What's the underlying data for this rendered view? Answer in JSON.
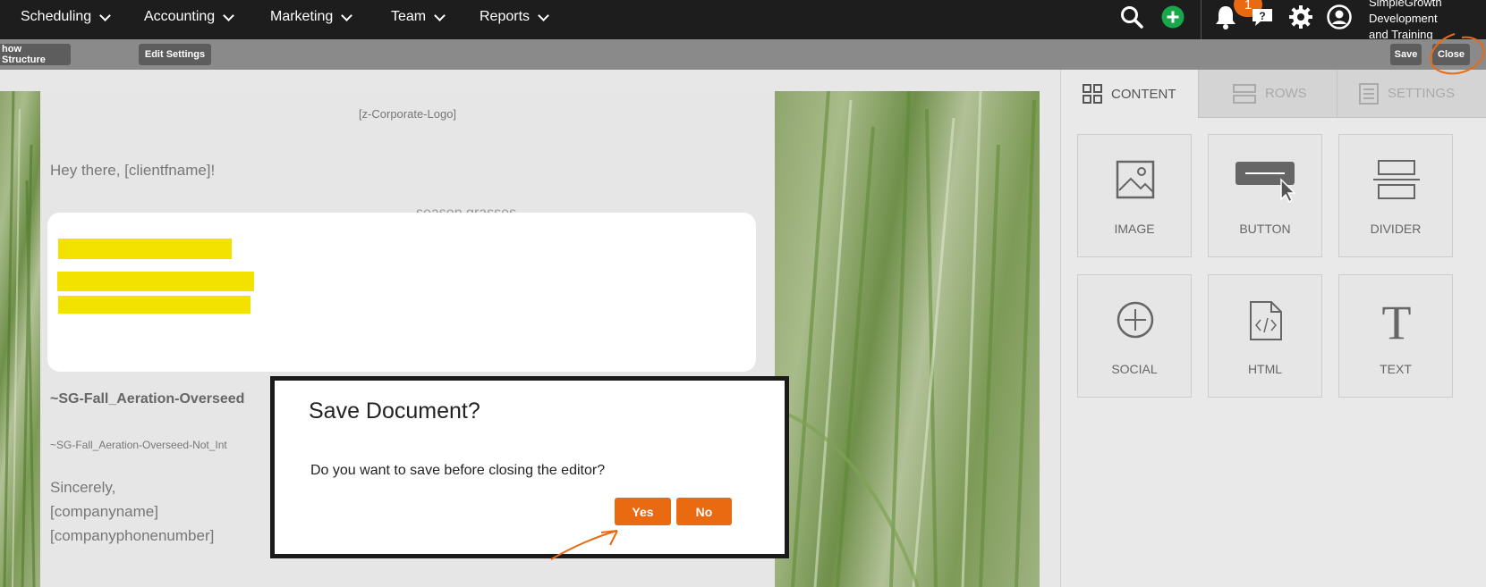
{
  "nav": {
    "items": [
      {
        "label": "Scheduling"
      },
      {
        "label": "Accounting"
      },
      {
        "label": "Marketing"
      },
      {
        "label": "Team"
      },
      {
        "label": "Reports"
      }
    ],
    "notification_count": "1",
    "account_name_lines": [
      "SimpleGrowth",
      "Development",
      "and Training"
    ],
    "colors": {
      "bar": "#1d1d1d",
      "add": "#1aa64a",
      "badge": "#ea6a12"
    }
  },
  "toolbar": {
    "structure_label": "how Structure",
    "settings_label": "Edit Settings",
    "save_label": "Save",
    "close_label": "Close"
  },
  "email": {
    "logo_placeholder": "[z-Corporate-Logo]",
    "greeting": "Hey there, [clientfname]!",
    "partial_line": "season grasses",
    "heading": "~SG-Fall_Aeration-Overseed",
    "small_line": "~SG-Fall_Aeration-Overseed-Not_Int",
    "signature": [
      "Sincerely,",
      "[companyname]",
      "[companyphonenumber]"
    ]
  },
  "panel": {
    "tabs": [
      {
        "label": "CONTENT",
        "icon": "grid-icon"
      },
      {
        "label": "ROWS",
        "icon": "rows-icon"
      },
      {
        "label": "SETTINGS",
        "icon": "settings-doc-icon"
      }
    ],
    "tiles": [
      {
        "label": "IMAGE",
        "icon": "image-icon"
      },
      {
        "label": "BUTTON",
        "icon": "button-icon"
      },
      {
        "label": "DIVIDER",
        "icon": "divider-icon"
      },
      {
        "label": "SOCIAL",
        "icon": "plus-circle-icon"
      },
      {
        "label": "HTML",
        "icon": "code-file-icon"
      },
      {
        "label": "TEXT",
        "icon": "text-t-icon"
      }
    ]
  },
  "dialog": {
    "title": "Save Document?",
    "message": "Do you want to save before closing the editor?",
    "yes_label": "Yes",
    "no_label": "No",
    "accent": "#ea6a12"
  }
}
